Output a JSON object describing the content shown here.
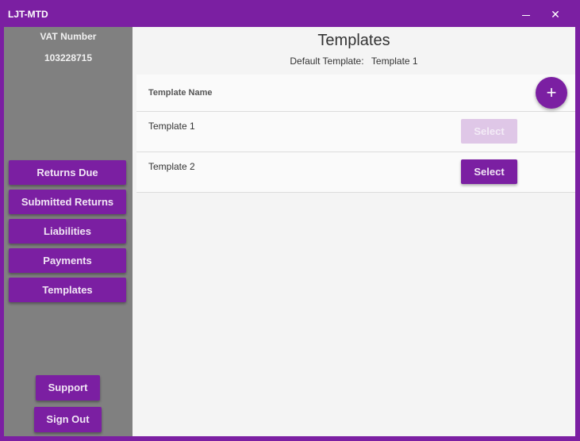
{
  "window": {
    "title": "LJT-MTD",
    "minimize_icon": "minimize-icon",
    "close_icon": "close-icon",
    "close_glyph": "✕"
  },
  "sidebar": {
    "vat_label": "VAT Number",
    "vat_number": "103228715",
    "nav": [
      {
        "label": "Returns Due"
      },
      {
        "label": "Submitted Returns"
      },
      {
        "label": "Liabilities"
      },
      {
        "label": "Payments"
      },
      {
        "label": "Templates"
      }
    ],
    "support_label": "Support",
    "signout_label": "Sign Out"
  },
  "main": {
    "title": "Templates",
    "default_label": "Default Template:",
    "default_value": "Template 1",
    "table": {
      "header_name": "Template Name",
      "add_glyph": "+",
      "rows": [
        {
          "name": "Template 1",
          "button": "Select",
          "enabled": false
        },
        {
          "name": "Template 2",
          "button": "Select",
          "enabled": true
        }
      ]
    }
  },
  "colors": {
    "accent": "#7b1fa2",
    "sidebar_bg": "#808080",
    "disabled_button": "#dfc7e7"
  }
}
